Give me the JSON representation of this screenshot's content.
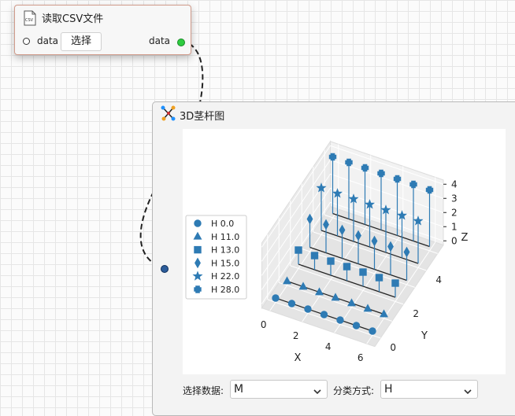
{
  "csv_node": {
    "title": "读取CSV文件",
    "input_label": "data",
    "select_button": "选择",
    "output_label": "data",
    "icon_text": "CSV"
  },
  "stem_node": {
    "title": "3D茎杆图",
    "select_data_label": "选择数据:",
    "select_data_value": "M",
    "classify_label": "分类方式:",
    "classify_value": "H"
  },
  "chart_data": {
    "type": "scatter",
    "kind": "3d-stem",
    "xlabel": "X",
    "ylabel": "Y",
    "zlabel": "Z",
    "x_ticks": [
      "0",
      "2",
      "4",
      "6"
    ],
    "y_ticks": [
      "0",
      "2",
      "4"
    ],
    "z_ticks": [
      "0",
      "1",
      "2",
      "3",
      "4"
    ],
    "legend_position": "left",
    "series": [
      {
        "name": "H 0.0",
        "marker": "circle",
        "y": 0,
        "z": 0,
        "x": [
          0,
          1,
          2,
          3,
          4,
          5,
          6
        ]
      },
      {
        "name": "H 11.0",
        "marker": "triangle",
        "y": 1,
        "z": 0,
        "x": [
          0,
          1,
          2,
          3,
          4,
          5,
          6
        ]
      },
      {
        "name": "H 13.0",
        "marker": "square",
        "y": 2,
        "z": 1,
        "x": [
          0,
          1,
          2,
          3,
          4,
          5,
          6
        ]
      },
      {
        "name": "H 15.0",
        "marker": "diamond",
        "y": 3,
        "z": 2,
        "x": [
          0,
          1,
          2,
          3,
          4,
          5,
          6
        ]
      },
      {
        "name": "H 22.0",
        "marker": "star",
        "y": 4,
        "z": 3,
        "x": [
          0,
          1,
          2,
          3,
          4,
          5,
          6
        ]
      },
      {
        "name": "H 28.0",
        "marker": "plus",
        "y": 5,
        "z": 4,
        "x": [
          0,
          1,
          2,
          3,
          4,
          5,
          6
        ]
      }
    ],
    "color": "#2e7bb4"
  }
}
